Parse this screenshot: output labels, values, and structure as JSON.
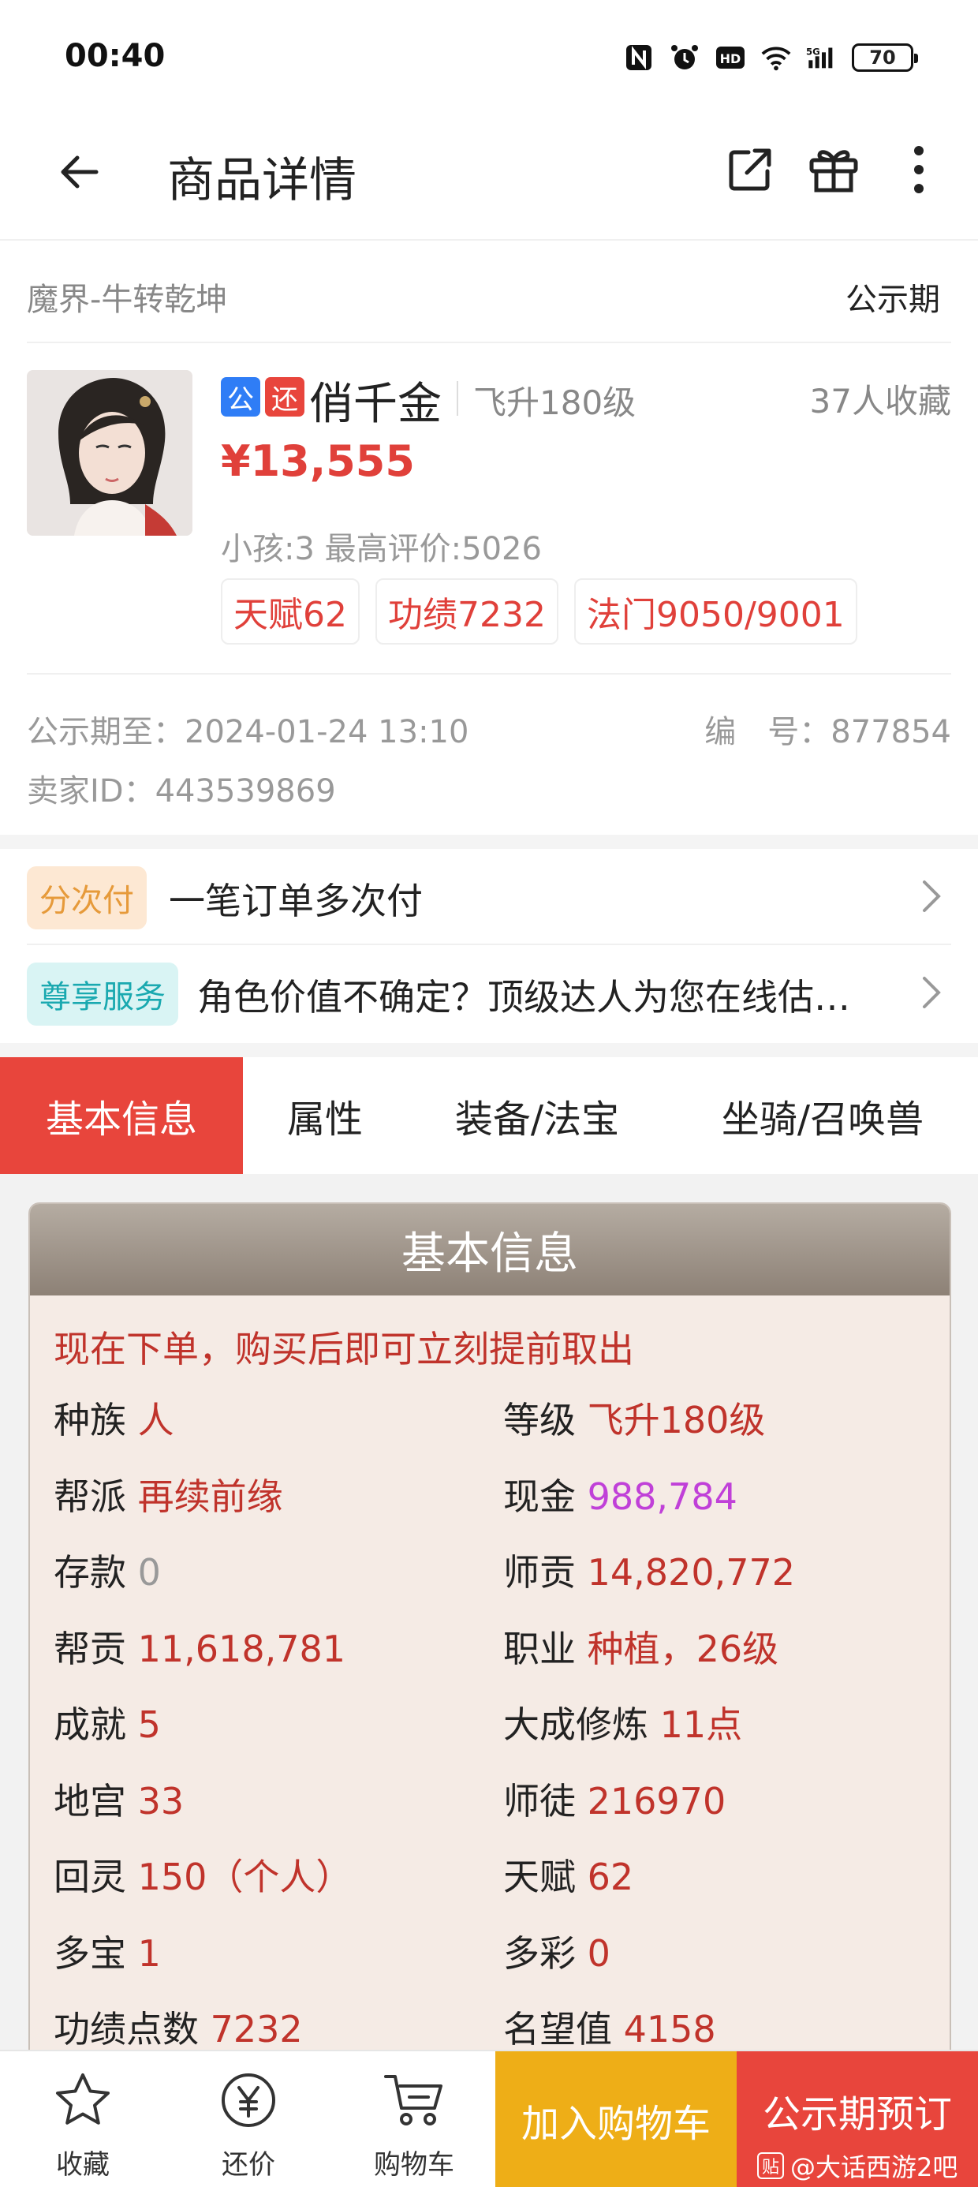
{
  "status_bar": {
    "time": "00:40",
    "battery": "70"
  },
  "appbar": {
    "title": "商品详情"
  },
  "server": {
    "name": "魔界-牛转乾坤",
    "phase": "公示期"
  },
  "product": {
    "badge_public": "公",
    "badge_return": "还",
    "name": "俏千金",
    "level": "飞升180级",
    "favorites": "37人收藏",
    "price": "¥13,555",
    "sub": "小孩:3 最高评价:5026",
    "tags": [
      "天赋62",
      "功绩7232",
      "法门9050/9001"
    ]
  },
  "meta": {
    "public_until": "公示期至：2024-01-24 13:10",
    "serial": "编　号：877854",
    "seller": "卖家ID：443539869"
  },
  "services": [
    {
      "pill": "分次付",
      "text": "一笔订单多次付"
    },
    {
      "pill": "尊享服务",
      "text": "角色价值不确定？顶级达人为您在线估…"
    }
  ],
  "tabs": [
    "基本信息",
    "属性",
    "装备/法宝",
    "坐骑/召唤兽"
  ],
  "panel": {
    "title": "基本信息",
    "notice": "现在下单，购买后即可立刻提前取出",
    "rows": [
      [
        {
          "label": "种族",
          "value": "人"
        },
        {
          "label": "等级",
          "value": "飞升180级"
        }
      ],
      [
        {
          "label": "帮派",
          "value": "再续前缘"
        },
        {
          "label": "现金",
          "value": "988,784"
        }
      ],
      [
        {
          "label": "存款",
          "value": "0"
        },
        {
          "label": "师贡",
          "value": "14,820,772"
        }
      ],
      [
        {
          "label": "帮贡",
          "value": "11,618,781"
        },
        {
          "label": "职业",
          "value": "种植，26级"
        }
      ],
      [
        {
          "label": "成就",
          "value": "5"
        },
        {
          "label": "大成修炼",
          "value": "11点"
        }
      ],
      [
        {
          "label": "地宫",
          "value": "33"
        },
        {
          "label": "师徒",
          "value": "216970"
        }
      ],
      [
        {
          "label": "回灵",
          "value": "150（个人）"
        },
        {
          "label": "天赋",
          "value": "62"
        }
      ],
      [
        {
          "label": "多宝",
          "value": "1"
        },
        {
          "label": "多彩",
          "value": "0"
        }
      ],
      [
        {
          "label": "功绩点数",
          "value": "7232"
        },
        {
          "label": "名望值",
          "value": "4158"
        }
      ]
    ]
  },
  "bottom_bar": {
    "favorite": "收藏",
    "bargain": "还价",
    "cart": "购物车",
    "add_to_cart": "加入购物车",
    "reserve": "公示期预订",
    "watermark": "@大话西游2吧",
    "watermark_logo": "贴"
  },
  "colors": {
    "accent_red": "#e8453c",
    "price_red": "#e0403a",
    "value_red": "#c0332b",
    "gold": "#eeae17",
    "purple": "#c040d8"
  }
}
